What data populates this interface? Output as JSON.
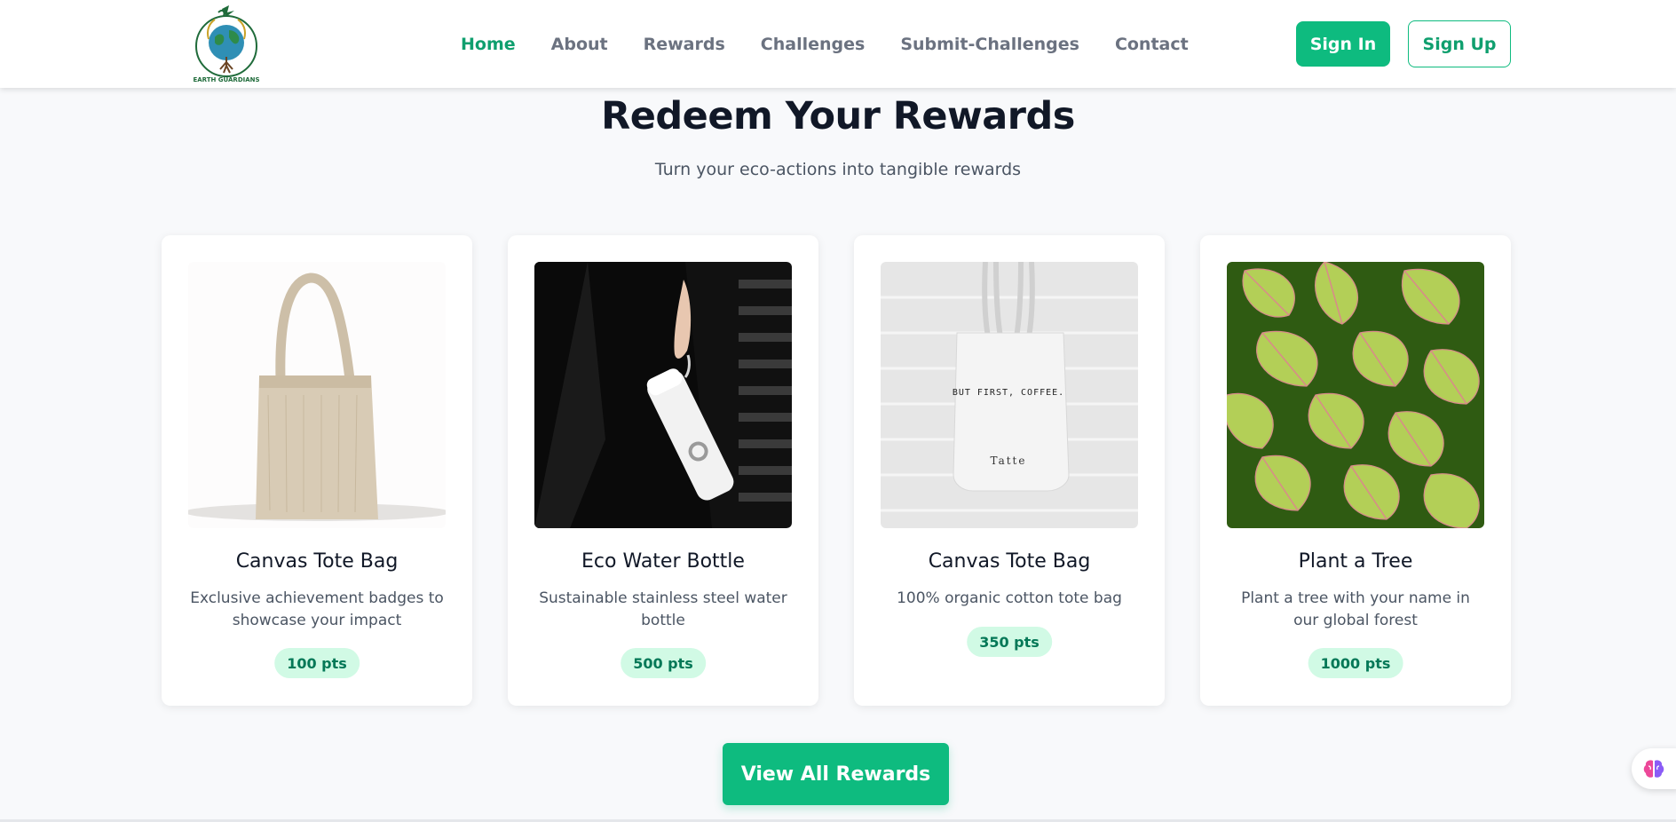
{
  "header": {
    "logo_text": "EARTH GUARDIANS",
    "nav": [
      {
        "label": "Home",
        "active": true
      },
      {
        "label": "About",
        "active": false
      },
      {
        "label": "Rewards",
        "active": false
      },
      {
        "label": "Challenges",
        "active": false
      },
      {
        "label": "Submit-Challenges",
        "active": false
      },
      {
        "label": "Contact",
        "active": false
      }
    ],
    "sign_in_label": "Sign In",
    "sign_up_label": "Sign Up"
  },
  "rewards": {
    "title": "Redeem Your Rewards",
    "subtitle": "Turn your eco-actions into tangible rewards",
    "cards": [
      {
        "title": "Canvas Tote Bag",
        "description": "Exclusive achievement badges to showcase your impact",
        "points": "100 pts",
        "image": "jute-tote-bag-image"
      },
      {
        "title": "Eco Water Bottle",
        "description": "Sustainable stainless steel water bottle",
        "points": "500 pts",
        "image": "water-bottle-image"
      },
      {
        "title": "Canvas Tote Bag",
        "description": "100% organic cotton tote bag",
        "points": "350 pts",
        "image": "canvas-tote-coffee-image",
        "tote_print": "BUT FIRST, COFFEE.",
        "tote_brand": "Tatte"
      },
      {
        "title": "Plant a Tree",
        "description": "Plant a tree with your name in our global forest",
        "points": "1000 pts",
        "image": "green-leaves-image"
      }
    ],
    "view_all_label": "View All Rewards"
  },
  "colors": {
    "brand_green": "#0ebb7f",
    "active_nav": "#0f9f6e",
    "badge_bg": "#d1fae5",
    "page_bg": "#f8f9fb"
  },
  "widgets": {
    "assistant_icon": "brain-icon"
  }
}
